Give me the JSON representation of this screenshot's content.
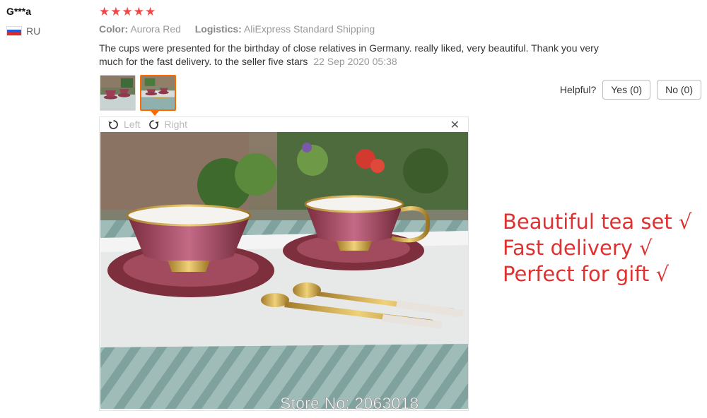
{
  "reviewer": {
    "name": "G***a",
    "country": "RU",
    "flag_colors": [
      "#ffffff",
      "#2a5bd7",
      "#e02a2a"
    ]
  },
  "rating": {
    "stars": 5,
    "max": 5,
    "star_glyph": "★",
    "color": "#f44848"
  },
  "meta": {
    "color_label": "Color:",
    "color_value": "Aurora Red",
    "logistics_label": "Logistics:",
    "logistics_value": "AliExpress Standard Shipping"
  },
  "review": {
    "text": "The cups were presented for the birthday of close relatives in Germany. really liked, very beautiful. Thank you very much for the fast delivery. to the seller five stars",
    "date": "22 Sep 2020 05:38"
  },
  "helpful": {
    "label": "Helpful?",
    "yes_label": "Yes (0)",
    "no_label": "No (0)"
  },
  "viewer": {
    "rotate_left_label": "Left",
    "rotate_right_label": "Right",
    "close_glyph": "✕",
    "accent": "#ff6a00"
  },
  "watermark": "Store No: 2063018",
  "promo": {
    "lines": [
      "Beautiful tea set √",
      "Fast delivery √",
      "Perfect for gift √"
    ],
    "color": "#e03131"
  }
}
